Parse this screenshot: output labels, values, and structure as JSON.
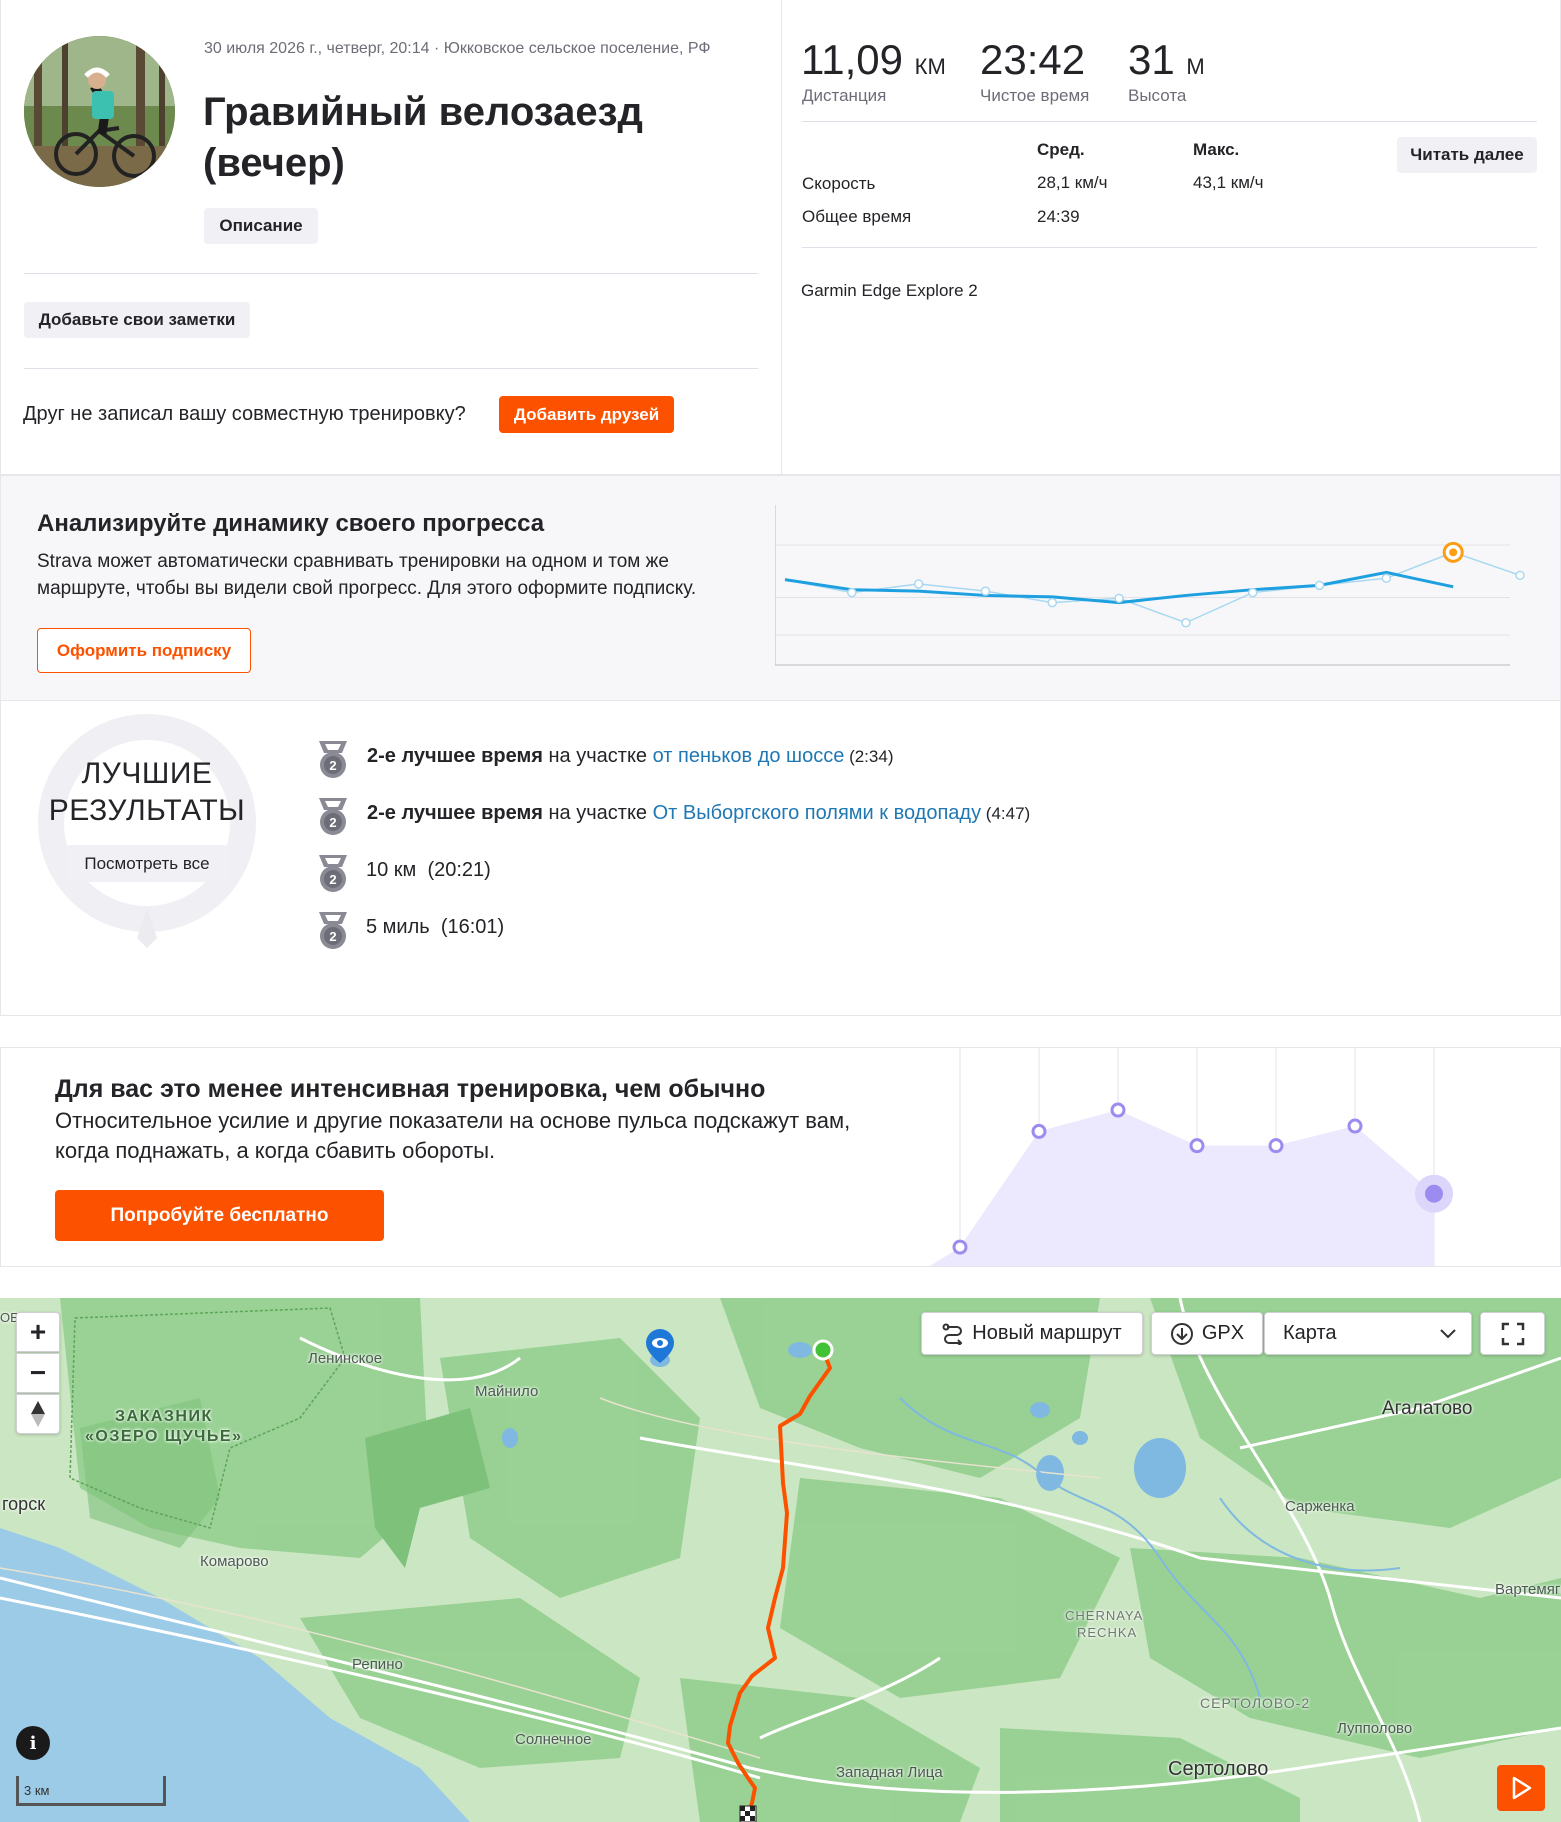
{
  "activity": {
    "meta": "30 июля 2026 г., четверг, 20:14 · Юкковское сельское поселение, РФ",
    "title_line1": "Гравийный велозаезд",
    "title_line2": "(вечер)",
    "description_button": "Описание",
    "notes_button": "Добавьте свои заметки",
    "friend_prompt": "Друг не записал вашу совместную тренировку?",
    "add_friends_button": "Добавить друзей"
  },
  "stats": {
    "distance_value": "11,09",
    "distance_unit": "км",
    "distance_label": "Дистанция",
    "moving_time_value": "23:42",
    "moving_time_label": "Чистое время",
    "elevation_value": "31",
    "elevation_unit": "м",
    "elevation_label": "Высота",
    "col_avg": "Сред.",
    "col_max": "Макс.",
    "read_more_button": "Читать далее",
    "speed_label": "Скорость",
    "speed_avg": "28,1 км/ч",
    "speed_max": "43,1 км/ч",
    "elapsed_label": "Общее время",
    "elapsed_avg": "24:39",
    "device": "Garmin Edge Explore 2"
  },
  "progress_promo": {
    "title": "Анализируйте динамику своего прогресса",
    "text_line1": "Strava может автоматически сравнивать тренировки на одном и том же",
    "text_line2": "маршруте, чтобы вы видели свой прогресс. Для этого оформите подписку.",
    "subscribe_button": "Оформить подписку",
    "chart_data": {
      "type": "line",
      "x": [
        1,
        2,
        3,
        4,
        5,
        6,
        7,
        8,
        9,
        10,
        11
      ],
      "series": [
        {
          "values": [
            4.2,
            3.5,
            3.4,
            3.1,
            3.0,
            2.6,
            3.1,
            3.5,
            3.8,
            4.7,
            3.7
          ]
        },
        {
          "values": [
            null,
            3.3,
            3.9,
            3.4,
            2.6,
            2.9,
            1.2,
            3.3,
            3.8,
            4.3,
            6.1,
            4.5
          ]
        }
      ],
      "highlight_index": 9,
      "grid": true,
      "colors": {
        "trend": "#1ea0e0",
        "points": "#a8d8f0",
        "highlight": "#fc9d12"
      }
    }
  },
  "best_efforts": {
    "badge_line1": "ЛУЧШИЕ",
    "badge_line2": "РЕЗУЛЬТАТЫ",
    "view_all_button": "Посмотреть все",
    "items": [
      {
        "rank": "2",
        "bold": "2-е лучшее время",
        "middle": " на участке ",
        "segment": "от пеньков до шоссе",
        "time": " (2:34)"
      },
      {
        "rank": "2",
        "bold": "2-е лучшее время",
        "middle": " на участке ",
        "segment": "От Выборгского полями к водопаду",
        "time": " (4:47)"
      },
      {
        "rank": "2",
        "name": "10 км",
        "time": "(20:21)"
      },
      {
        "rank": "2",
        "name": "5 миль",
        "time": "(16:01)"
      }
    ]
  },
  "effort_promo": {
    "title": "Для вас это менее интенсивная тренировка, чем обычно",
    "text_line1": "Относительное усилие и другие показатели на основе пульса подскажут вам,",
    "text_line2": "когда поднажать, а когда сбавить обороты.",
    "try_button": "Попробуйте бесплатно",
    "chart_data": {
      "type": "area",
      "x": [
        1,
        2,
        3,
        4,
        5,
        6,
        7
      ],
      "values": [
        0.05,
        0.7,
        0.82,
        0.62,
        0.62,
        0.73,
        0.35
      ],
      "highlight_index": 6,
      "colors": {
        "fill": "#ece8fd",
        "point": "#9c8cf0"
      }
    }
  },
  "map": {
    "new_route_button": "Новый маршрут",
    "gpx_button": "GPX",
    "map_type_value": "Карта",
    "scale_label": "3 км",
    "places": {
      "leninskoe": "Ленинское",
      "maynilo": "Майнило",
      "zakaznik1": "ЗАКАЗНИК",
      "zakaznik2": "«ОЗЕРО ЩУЧЬЕ»",
      "gorsk": "горск",
      "komarovo": "Комарово",
      "repino": "Репино",
      "solnechnoe": "Солнечное",
      "zapadnaya": "Западная Лица",
      "agalatovo": "Агалатово",
      "sarzhenka": "Сарженка",
      "vartemyagi": "Вартемяги",
      "chernaya1": "CHERNAYA",
      "chernaya2": "RECHKA",
      "sertolovo2": "СЕРТОЛОВО-2",
      "lupolovo": "Лупполово",
      "sertolovo": "Сертолово",
      "ob": "ОБ"
    },
    "colors": {
      "water": "#9ccbe8",
      "forest": "#8fcf8d",
      "route": "#fc5200"
    }
  }
}
